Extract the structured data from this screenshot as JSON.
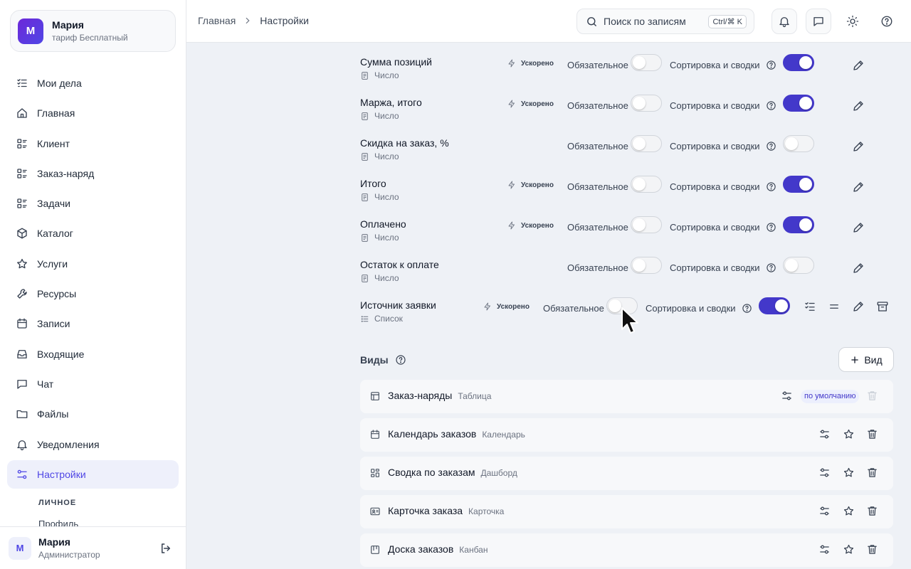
{
  "account": {
    "initial": "М",
    "name": "Мария",
    "plan": "тариф Бесплатный"
  },
  "nav": [
    {
      "label": "Мои дела",
      "icon": "task-list-icon"
    },
    {
      "label": "Главная",
      "icon": "home-icon"
    },
    {
      "label": "Клиент",
      "icon": "entity-list-icon"
    },
    {
      "label": "Заказ-наряд",
      "icon": "entity-list-icon"
    },
    {
      "label": "Задачи",
      "icon": "entity-list-icon"
    },
    {
      "label": "Каталог",
      "icon": "box-icon"
    },
    {
      "label": "Услуги",
      "icon": "star-icon"
    },
    {
      "label": "Ресурсы",
      "icon": "wrench-icon"
    },
    {
      "label": "Записи",
      "icon": "calendar-icon"
    },
    {
      "label": "Входящие",
      "icon": "inbox-icon"
    },
    {
      "label": "Чат",
      "icon": "chat-icon"
    },
    {
      "label": "Файлы",
      "icon": "folder-icon"
    },
    {
      "label": "Уведомления",
      "icon": "bell-icon"
    },
    {
      "label": "Настройки",
      "icon": "settings-sliders-icon",
      "active": true
    }
  ],
  "submenu": {
    "heading": "ЛИЧНОЕ",
    "item": "Профиль"
  },
  "user": {
    "initial": "М",
    "name": "Мария",
    "role": "Администратор"
  },
  "breadcrumb": {
    "home": "Главная",
    "current": "Настройки"
  },
  "search": {
    "placeholder": "Поиск по записям",
    "shortcut": "Ctrl/⌘ K"
  },
  "labels": {
    "accelerated": "Ускорено",
    "required": "Обязательное",
    "sorting": "Сортировка и сводки",
    "views_title": "Виды",
    "add_view": "Вид",
    "default_badge": "по умолчанию"
  },
  "fields": [
    {
      "name": "Сумма позиций",
      "type": "Число",
      "accelerated": true,
      "required": false,
      "sorting": true
    },
    {
      "name": "Маржа, итого",
      "type": "Число",
      "accelerated": true,
      "required": false,
      "sorting": true
    },
    {
      "name": "Скидка на заказ, %",
      "type": "Число",
      "accelerated": false,
      "required": false,
      "sorting": false
    },
    {
      "name": "Итого",
      "type": "Число",
      "accelerated": true,
      "required": false,
      "sorting": true
    },
    {
      "name": "Оплачено",
      "type": "Число",
      "accelerated": true,
      "required": false,
      "sorting": true
    },
    {
      "name": "Остаток к оплате",
      "type": "Число",
      "accelerated": false,
      "required": false,
      "sorting": false
    },
    {
      "name": "Источник заявки",
      "type": "Список",
      "accelerated": true,
      "required": false,
      "sorting": true
    }
  ],
  "views": [
    {
      "name": "Заказ-наряды",
      "type": "Таблица",
      "icon": "table-icon",
      "default": true
    },
    {
      "name": "Календарь заказов",
      "type": "Календарь",
      "icon": "calendar-icon",
      "default": false
    },
    {
      "name": "Сводка по заказам",
      "type": "Дашборд",
      "icon": "dashboard-icon",
      "default": false
    },
    {
      "name": "Карточка заказа",
      "type": "Карточка",
      "icon": "card-icon",
      "default": false
    },
    {
      "name": "Доска заказов",
      "type": "Канбан",
      "icon": "kanban-icon",
      "default": false
    }
  ]
}
